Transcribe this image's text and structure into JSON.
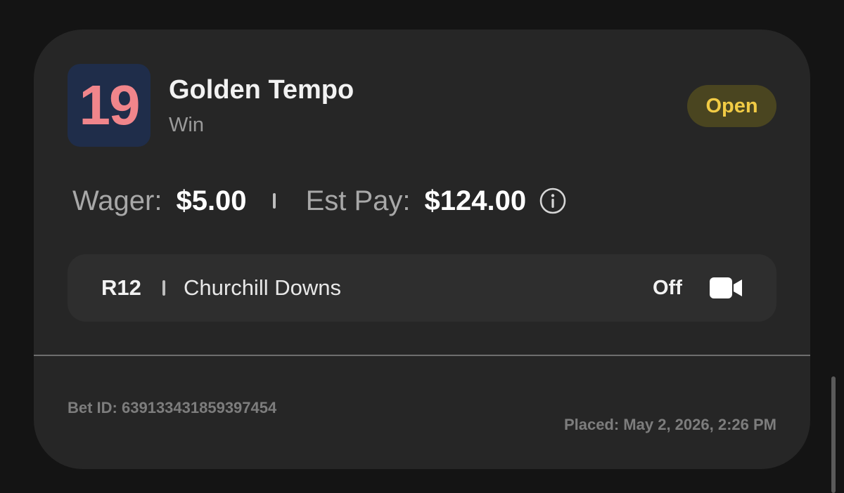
{
  "bet": {
    "saddle_number": "19",
    "horse_name": "Golden Tempo",
    "bet_type": "Win",
    "status": "Open",
    "wager_label": "Wager:",
    "wager_value": "$5.00",
    "est_pay_label": "Est Pay:",
    "est_pay_value": "$124.00",
    "info_icon": "info-circle-icon"
  },
  "race": {
    "number": "R12",
    "track": "Churchill Downs",
    "video_status": "Off",
    "video_icon": "video-camera-icon"
  },
  "footer": {
    "bet_id": "Bet ID: 639133431859397454",
    "placed": "Placed: May 2, 2026, 2:26 PM"
  },
  "colors": {
    "background": "#141414",
    "card": "#262626",
    "saddle_bg": "#1f2d4a",
    "saddle_text": "#f0858b",
    "status_bg": "#4a4520",
    "status_text": "#f1cb45"
  }
}
